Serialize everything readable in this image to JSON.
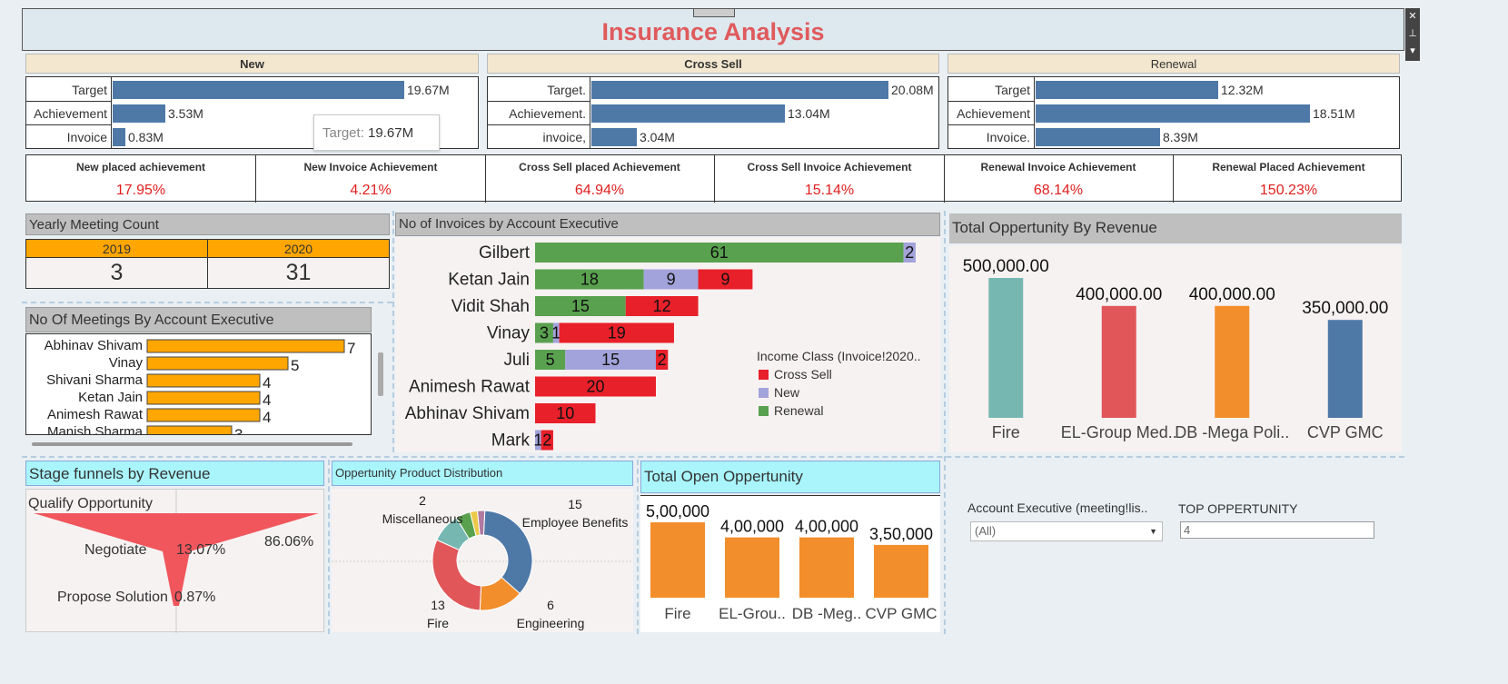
{
  "title": "Insurance Analysis",
  "tooltip": {
    "label": "Target:",
    "value": "19.67M"
  },
  "window_controls": {
    "close": "✕",
    "pin": "⊥",
    "menu": "▾"
  },
  "kpi_panels": [
    {
      "header": "New",
      "rows": [
        {
          "label": "Target",
          "value": 19.67,
          "text": "19.67M"
        },
        {
          "label": "Achievement",
          "value": 3.53,
          "text": "3.53M"
        },
        {
          "label": "Invoice",
          "value": 0.83,
          "text": "0.83M"
        }
      ]
    },
    {
      "header": "Cross Sell",
      "rows": [
        {
          "label": "Target.",
          "value": 20.08,
          "text": "20.08M"
        },
        {
          "label": "Achievement.",
          "value": 13.04,
          "text": "13.04M"
        },
        {
          "label": "invoice,",
          "value": 3.04,
          "text": "3.04M"
        }
      ]
    },
    {
      "header": "Renewal",
      "rows": [
        {
          "label": "Target",
          "value": 12.32,
          "text": "12.32M"
        },
        {
          "label": "Achievement",
          "value": 18.51,
          "text": "18.51M"
        },
        {
          "label": "Invoice.",
          "value": 8.39,
          "text": "8.39M"
        }
      ]
    }
  ],
  "metrics": [
    {
      "label": "New placed achievement",
      "value": "17.95%"
    },
    {
      "label": "New Invoice Achievement",
      "value": "4.21%"
    },
    {
      "label": "Cross Sell placed Achievement",
      "value": "64.94%"
    },
    {
      "label": "Cross Sell Invoice Achievement",
      "value": "15.14%"
    },
    {
      "label": "Renewal Invoice Achievement",
      "value": "68.14%"
    },
    {
      "label": "Renewal Placed Achievement",
      "value": "150.23%"
    }
  ],
  "yearly_meeting": {
    "title": "Yearly Meeting Count",
    "years": [
      "2019",
      "2020"
    ],
    "counts": [
      "3",
      "31"
    ]
  },
  "meetings_by_exec": {
    "title": "No Of Meetings By Account Executive"
  },
  "invoices_by_exec": {
    "title": "No of Invoices by Account Executive"
  },
  "total_opportunity_revenue": {
    "title": "Total Oppertunity By Revenue"
  },
  "stage_funnels": {
    "title": "Stage funnels by Revenue"
  },
  "product_distribution": {
    "title": "Oppertunity Product Distribution"
  },
  "total_open_opportunity": {
    "title": "Total Open Oppertunity"
  },
  "filters": {
    "account_exec_label": "Account Executive (meeting!lis..",
    "account_exec_value": "(All)",
    "top_opp_label": "TOP OPPERTUNITY",
    "top_opp_value": "4"
  },
  "colors": {
    "bar_blue": "#4e79a7",
    "orange": "#ffa600",
    "cross_sell": "#e8202a",
    "new": "#a3a3db",
    "renewal": "#59a14f",
    "teal": "#76b7b2",
    "red": "#e15759",
    "orange2": "#f28e2b",
    "funnel": "#f0565c",
    "metric_red": "#e0201f"
  },
  "chart_data": [
    {
      "type": "bar",
      "orientation": "horizontal",
      "title": "No Of Meetings By Account Executive",
      "categories": [
        "Abhinav Shivam",
        "Vinay",
        "Shivani Sharma",
        "Ketan Jain",
        "Animesh Rawat",
        "Manish Sharma"
      ],
      "values": [
        7,
        5,
        4,
        4,
        4,
        3
      ]
    },
    {
      "type": "bar",
      "orientation": "horizontal",
      "stacked": true,
      "title": "No of Invoices by Account Executive",
      "legend_title": "Income Class (Invoice!2020..",
      "legend_position": "right",
      "categories": [
        "Gilbert",
        "Ketan Jain",
        "Vidit Shah",
        "Vinay",
        "Juli",
        "Animesh Rawat",
        "Abhinav Shivam",
        "Mark"
      ],
      "series": [
        {
          "name": "Renewal",
          "values": [
            61,
            18,
            15,
            3,
            5,
            0,
            0,
            0
          ]
        },
        {
          "name": "New",
          "values": [
            2,
            9,
            0,
            1,
            15,
            0,
            0,
            1
          ]
        },
        {
          "name": "Cross Sell",
          "values": [
            0,
            9,
            12,
            19,
            2,
            20,
            10,
            2
          ]
        }
      ],
      "legend": [
        "Cross Sell",
        "New",
        "Renewal"
      ]
    },
    {
      "type": "bar",
      "title": "Total Oppertunity By Revenue",
      "categories": [
        "Fire",
        "EL-Group Med..",
        "DB -Mega Poli..",
        "CVP GMC"
      ],
      "values": [
        500000,
        400000,
        400000,
        350000
      ],
      "labels": [
        "500,000.00",
        "400,000.00",
        "400,000.00",
        "350,000.00"
      ],
      "ylim": [
        0,
        500000
      ]
    },
    {
      "type": "area",
      "title": "Stage funnels by Revenue",
      "categories": [
        "Qualify Opportunity",
        "Negotiate",
        "Propose Solution"
      ],
      "labels": [
        "86.06%",
        "13.07%",
        "0.87%"
      ],
      "values": [
        86.06,
        13.07,
        0.87
      ]
    },
    {
      "type": "pie",
      "donut": true,
      "title": "Oppertunity Product Distribution",
      "slices": [
        {
          "name": "Employee Benefits",
          "value": 15
        },
        {
          "name": "Engineering",
          "value": 6
        },
        {
          "name": "Fire",
          "value": 13
        },
        {
          "name": "",
          "value": 4
        },
        {
          "name": "Miscellaneous",
          "value": 2
        },
        {
          "name": "",
          "value": 1
        },
        {
          "name": "",
          "value": 1
        }
      ],
      "labels": [
        {
          "name": "Employee Benefits",
          "value": "15"
        },
        {
          "name": "Engineering",
          "value": "6"
        },
        {
          "name": "Fire",
          "value": "13"
        },
        {
          "name": "Miscellaneous",
          "value": "2"
        }
      ]
    },
    {
      "type": "bar",
      "title": "Total Open Oppertunity",
      "categories": [
        "Fire",
        "EL-Grou..",
        "DB -Meg..",
        "CVP GMC"
      ],
      "values": [
        500000,
        400000,
        400000,
        350000
      ],
      "labels": [
        "5,00,000",
        "4,00,000",
        "4,00,000",
        "3,50,000"
      ]
    }
  ]
}
